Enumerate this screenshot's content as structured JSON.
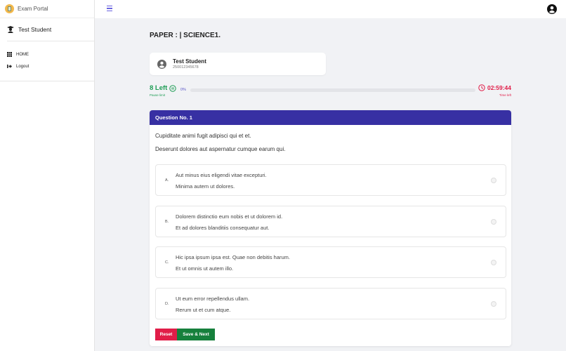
{
  "app": {
    "name": "Exam Portal"
  },
  "sidebar": {
    "user": "Test Student",
    "items": [
      {
        "label": "HOME"
      },
      {
        "label": "Logout"
      }
    ]
  },
  "paper": {
    "title": "PAPER : | SCIENCE1."
  },
  "student": {
    "name": "Test Student",
    "id": "250012345678"
  },
  "progress": {
    "pauses_left": "8 Left",
    "pause_label": "Pause limit",
    "percent_text": "0%",
    "percent": 0,
    "time": "02:59:44",
    "time_label": "Time left"
  },
  "question": {
    "header": "Question No. 1",
    "lines": [
      "Cupiditate animi fugit adipisci qui et et.",
      "Deserunt dolores aut aspernatur cumque earum qui."
    ],
    "options": [
      {
        "letter": "A.",
        "line1": "Aut minus eius eligendi vitae excepturi.",
        "line2": "Minima autem ut dolores."
      },
      {
        "letter": "B.",
        "line1": "Dolorem distinctio eum nobis et ut dolorem id.",
        "line2": "Et ad dolores blanditiis consequatur aut."
      },
      {
        "letter": "C.",
        "line1": "Hic ipsa ipsum ipsa est. Quae non debitis harum.",
        "line2": "Et ut omnis ut autem illo."
      },
      {
        "letter": "D.",
        "line1": "Ut eum error repellendus ullam.",
        "line2": "Rerum ut et cum atque."
      }
    ]
  },
  "buttons": {
    "reset": "Reset",
    "save_next": "Save & Next"
  },
  "colors": {
    "header": "#3730a3",
    "reset": "#e11d48",
    "save": "#16803c"
  }
}
